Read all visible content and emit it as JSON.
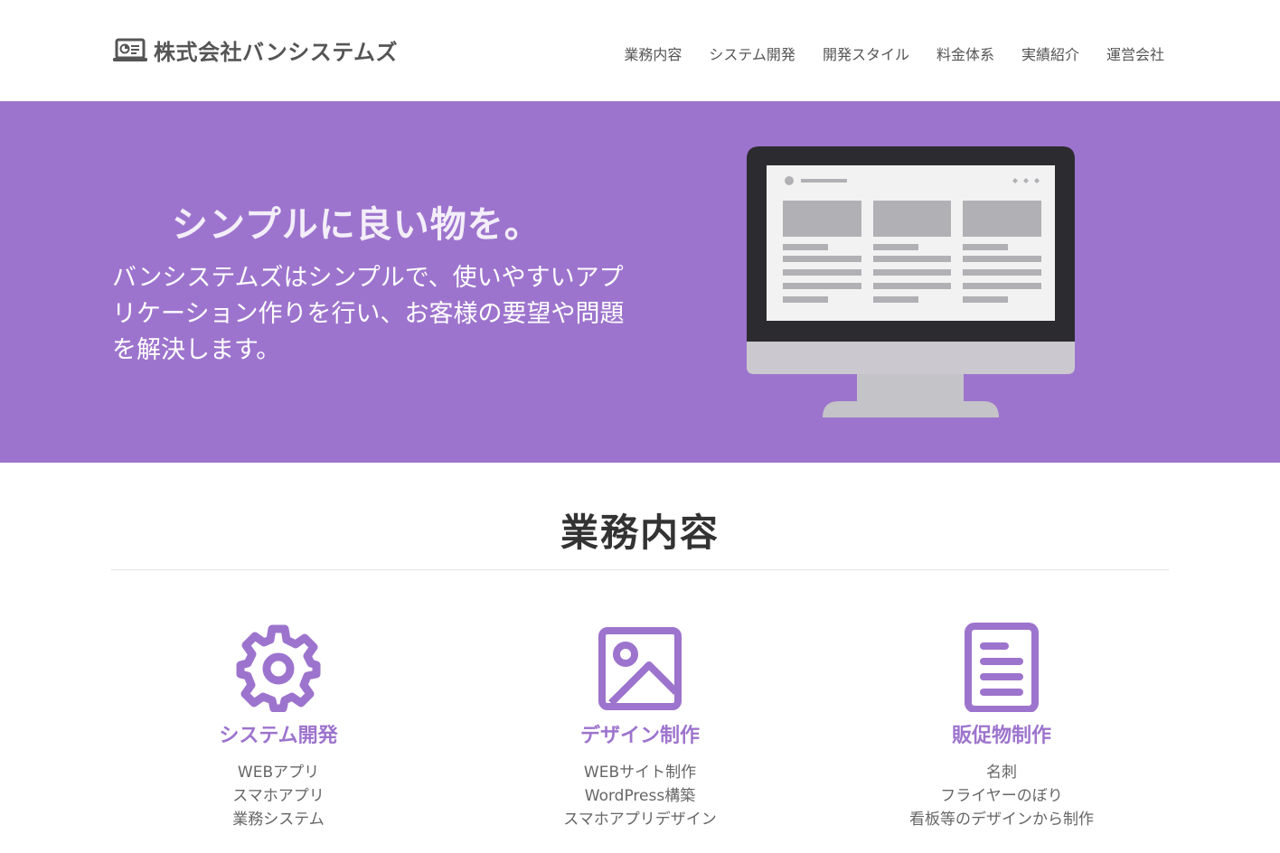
{
  "header": {
    "logo_text": "株式会社バンシステムズ",
    "logo_icon": "laptop-chart-icon",
    "nav": [
      {
        "label": "業務内容"
      },
      {
        "label": "システム開発"
      },
      {
        "label": "開発スタイル"
      },
      {
        "label": "料金体系"
      },
      {
        "label": "実績紹介"
      },
      {
        "label": "運営会社"
      }
    ]
  },
  "hero": {
    "title": "シンプルに良い物を。",
    "body": "バンシステムズはシンプルで、使いやすいアプリケーション作りを行い、お客様の要望や問題を解決します。",
    "illustration": "desktop-monitor-icon"
  },
  "services": {
    "title": "業務内容",
    "items": [
      {
        "icon": "gear-icon",
        "title": "システム開発",
        "lines": [
          "WEBアプリ",
          "スマホアプリ",
          "業務システム"
        ]
      },
      {
        "icon": "image-icon",
        "title": "デザイン制作",
        "lines": [
          "WEBサイト制作",
          "WordPress構築",
          "スマホアプリデザイン"
        ]
      },
      {
        "icon": "document-icon",
        "title": "販促物制作",
        "lines": [
          "名刺",
          "フライヤーのぼり",
          "看板等のデザインから制作"
        ]
      }
    ]
  },
  "colors": {
    "accent": "#9d74cd",
    "hero_text": "#ffffff",
    "body_text": "#555555"
  }
}
